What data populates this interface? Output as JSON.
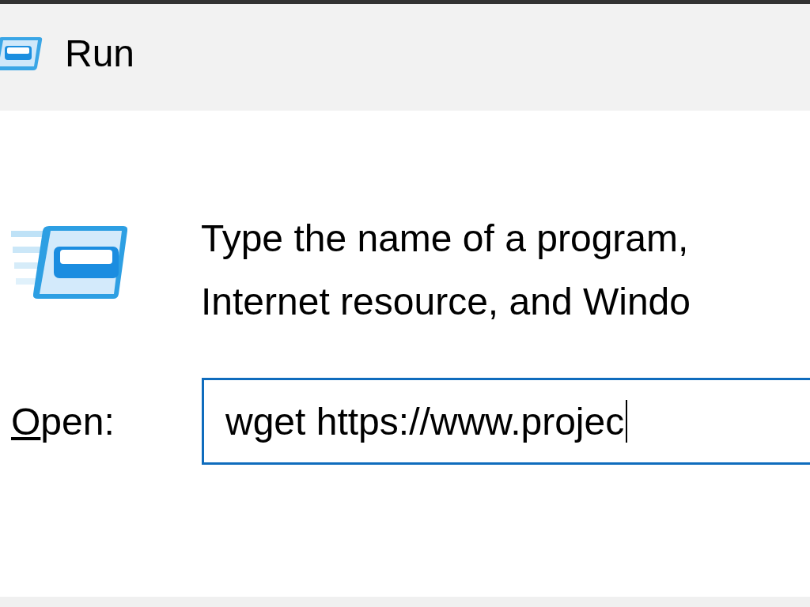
{
  "window": {
    "title": "Run"
  },
  "description": [
    "Type the name of a program,",
    "Internet resource, and Windo"
  ],
  "open_field": {
    "label": "Open:",
    "value": "wget https://www.projec",
    "focused": true
  }
}
